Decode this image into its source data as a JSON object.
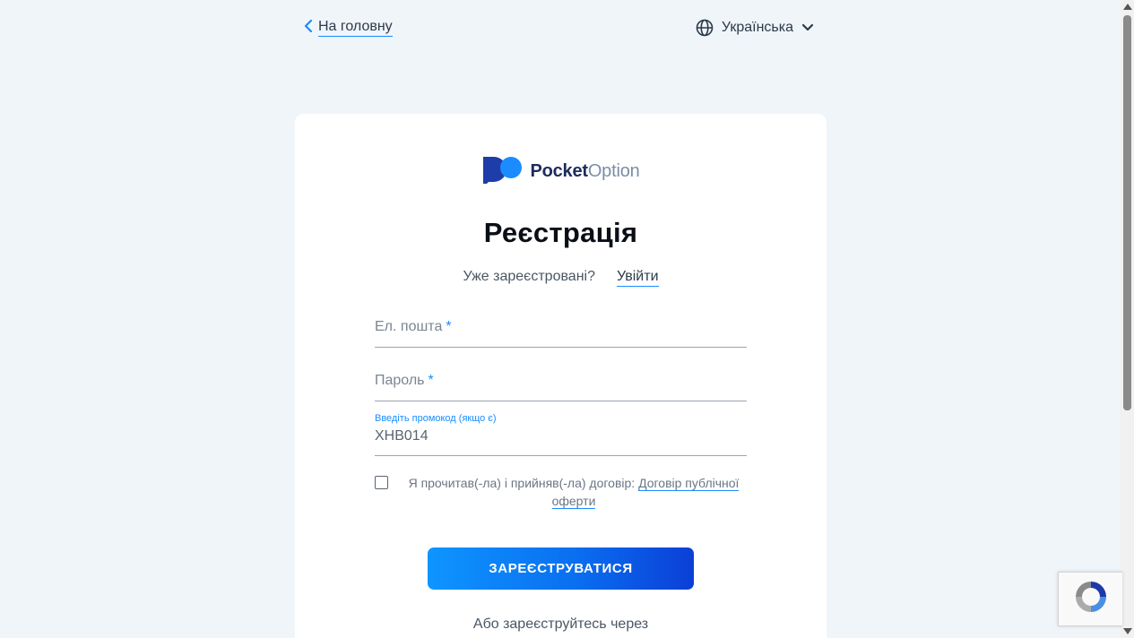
{
  "nav": {
    "back_label": "На головну",
    "language": "Українська"
  },
  "brand": {
    "name_bold": "Pocket",
    "name_light": "Option",
    "color_primary": "#1a8cff",
    "color_dark": "#1e2b5c"
  },
  "form": {
    "title": "Реєстрація",
    "already_registered": "Уже зареєстровані?",
    "login_link": "Увійти",
    "email_placeholder": "Ел. пошта",
    "password_placeholder": "Пароль",
    "required_mark": "*",
    "promo_label": "Введіть промокод (якщо є)",
    "promo_value": "XHB014",
    "agree_text": "Я прочитав(-ла) і прийняв(-ла) договір:",
    "agree_link": "Договір публічної оферти",
    "agree_checked": false,
    "submit_label": "ЗАРЕЄСТРУВАТИСЯ",
    "alt_text": "Або зареєструйтесь через"
  },
  "icons": {
    "back": "chevron-left-icon",
    "globe": "globe-icon",
    "dropdown": "chevron-down-icon",
    "recaptcha": "recaptcha-icon"
  }
}
